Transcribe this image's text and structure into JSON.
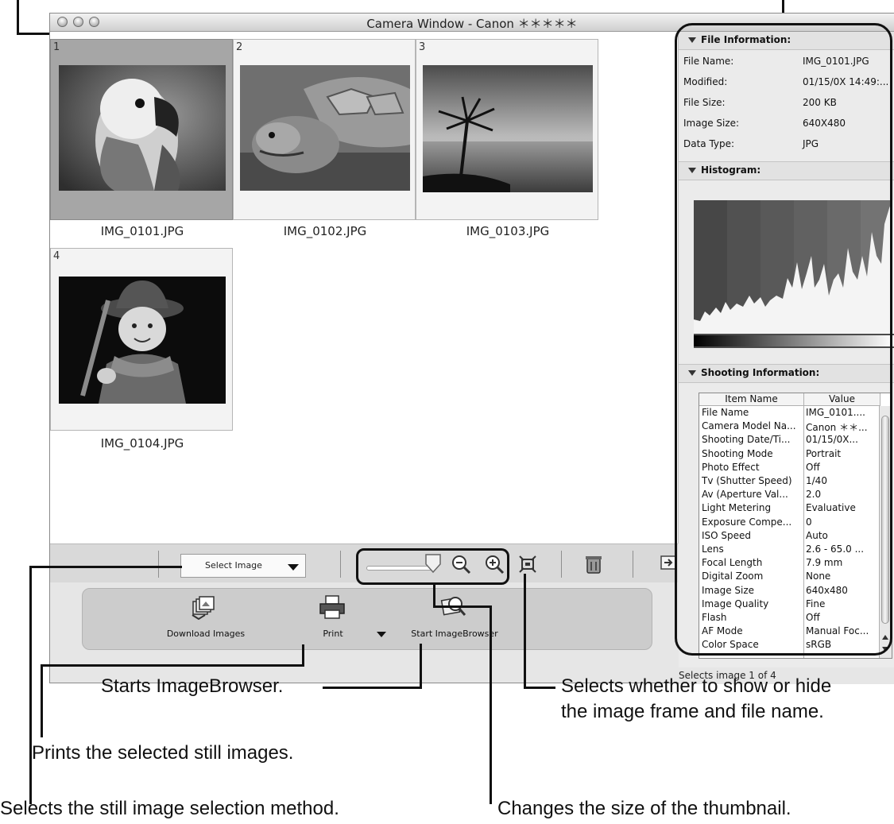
{
  "window": {
    "title": "Camera Window - Canon ＊＊＊＊＊"
  },
  "thumbnails": [
    {
      "number": "1",
      "filename": "IMG_0101.JPG",
      "selected": true,
      "subject": "parrot"
    },
    {
      "number": "2",
      "filename": "IMG_0102.JPG",
      "selected": false,
      "subject": "tortoise"
    },
    {
      "number": "3",
      "filename": "IMG_0103.JPG",
      "selected": false,
      "subject": "palm sunset"
    },
    {
      "number": "4",
      "filename": "IMG_0104.JPG",
      "selected": false,
      "subject": "child in hat"
    }
  ],
  "toolbar": {
    "select_label": "Select Image",
    "thumbnail_size_level": 0.92
  },
  "launch_panel": {
    "download_label": "Download Images",
    "print_label": "Print",
    "browser_label": "Start ImageBrowser"
  },
  "file_info": {
    "header": "File Information:",
    "rows": [
      {
        "label": "File Name:",
        "value": "IMG_0101.JPG"
      },
      {
        "label": "Modified:",
        "value": "01/15/0X 14:49:..."
      },
      {
        "label": "File Size:",
        "value": "200 KB"
      },
      {
        "label": "Image Size:",
        "value": "640X480"
      },
      {
        "label": "Data Type:",
        "value": "JPG"
      }
    ]
  },
  "histogram": {
    "header": "Histogram:"
  },
  "shooting_info": {
    "header": "Shooting Information:",
    "col_item": "Item Name",
    "col_value": "Value",
    "rows": [
      {
        "name": "File Name",
        "value": "IMG_0101...."
      },
      {
        "name": "Camera Model Na...",
        "value": "Canon ＊＊..."
      },
      {
        "name": "Shooting Date/Ti...",
        "value": "01/15/0X..."
      },
      {
        "name": "Shooting Mode",
        "value": "Portrait"
      },
      {
        "name": "Photo Effect",
        "value": "Off"
      },
      {
        "name": "Tv (Shutter Speed)",
        "value": "1/40"
      },
      {
        "name": "Av (Aperture Val...",
        "value": "2.0"
      },
      {
        "name": "Light Metering",
        "value": "Evaluative"
      },
      {
        "name": "Exposure Compe...",
        "value": "0"
      },
      {
        "name": "ISO Speed",
        "value": "Auto"
      },
      {
        "name": "Lens",
        "value": "2.6 - 65.0 ..."
      },
      {
        "name": "Focal Length",
        "value": "7.9 mm"
      },
      {
        "name": "Digital Zoom",
        "value": "None"
      },
      {
        "name": "Image Size",
        "value": "640x480"
      },
      {
        "name": "Image Quality",
        "value": "Fine"
      },
      {
        "name": "Flash",
        "value": "Off"
      },
      {
        "name": "AF Mode",
        "value": "Manual Foc..."
      },
      {
        "name": "Color Space",
        "value": "sRGB"
      }
    ]
  },
  "status": "Selects image 1 of 4",
  "callouts": {
    "browser": "Starts ImageBrowser.",
    "frame1": "Selects whether to show or hide",
    "frame2": "the image frame and file name.",
    "print": "Prints the selected still images.",
    "selection": "Selects the still image selection method.",
    "size": "Changes the size of the thumbnail."
  }
}
